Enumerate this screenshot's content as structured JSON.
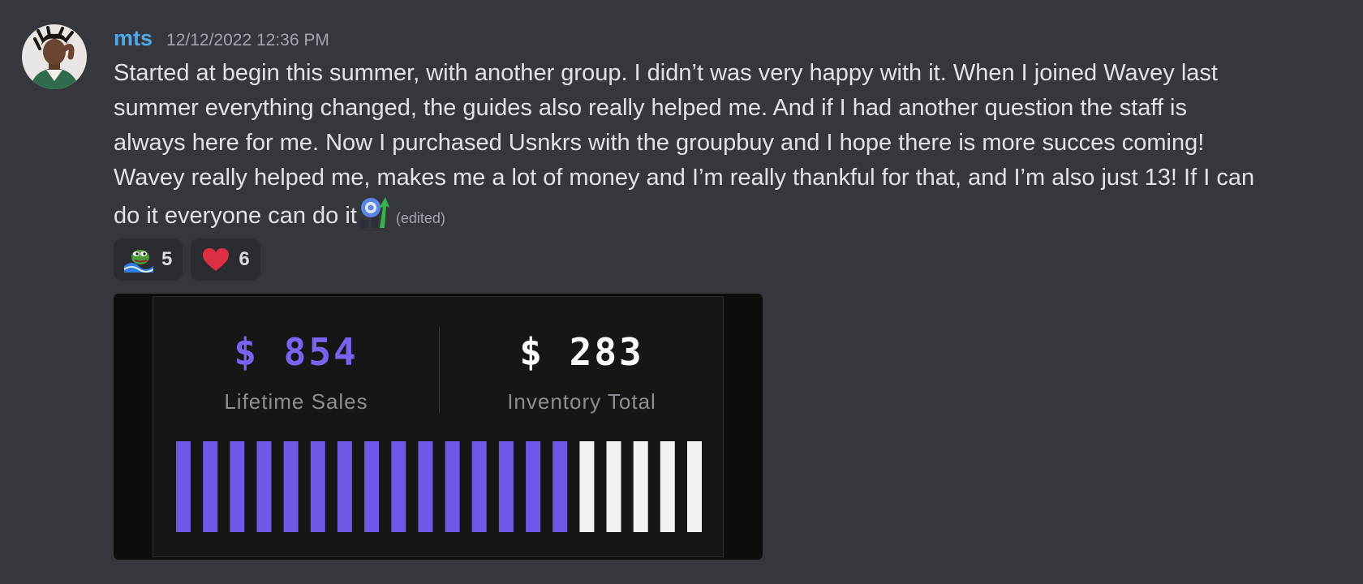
{
  "message": {
    "username": "mts",
    "timestamp": "12/12/2022 12:36 PM",
    "lines": [
      "Started at begin this summer, with another group. I didn’t was very happy with it. When I joined Wavey last",
      "summer everything changed, the guides also really helped me. And if I had another question the staff is",
      "always here for me. Now I purchased Usnkrs with the groupbuy and I hope there is more succes coming!",
      "Wavey really helped me, makes me a lot of money and I’m really thankful for that, and I’m also just 13! If I can",
      "do it everyone can do it"
    ],
    "edited_label": "(edited)",
    "inline_emoji": "growth-chart-emoji"
  },
  "reactions": [
    {
      "icon": "pepe-wave-emoji",
      "count": "5"
    },
    {
      "icon": "red-heart-emoji",
      "count": "6"
    }
  ],
  "attachment": {
    "stats": [
      {
        "value": "$ 854",
        "label": "Lifetime Sales",
        "color": "#7a63f0"
      },
      {
        "value": "$ 283",
        "label": "Inventory Total",
        "color": "#ffffff"
      }
    ],
    "bars": {
      "total": 20,
      "filled": 15,
      "filled_color": "#6f57e8",
      "empty_color": "#f2f2f2"
    }
  }
}
